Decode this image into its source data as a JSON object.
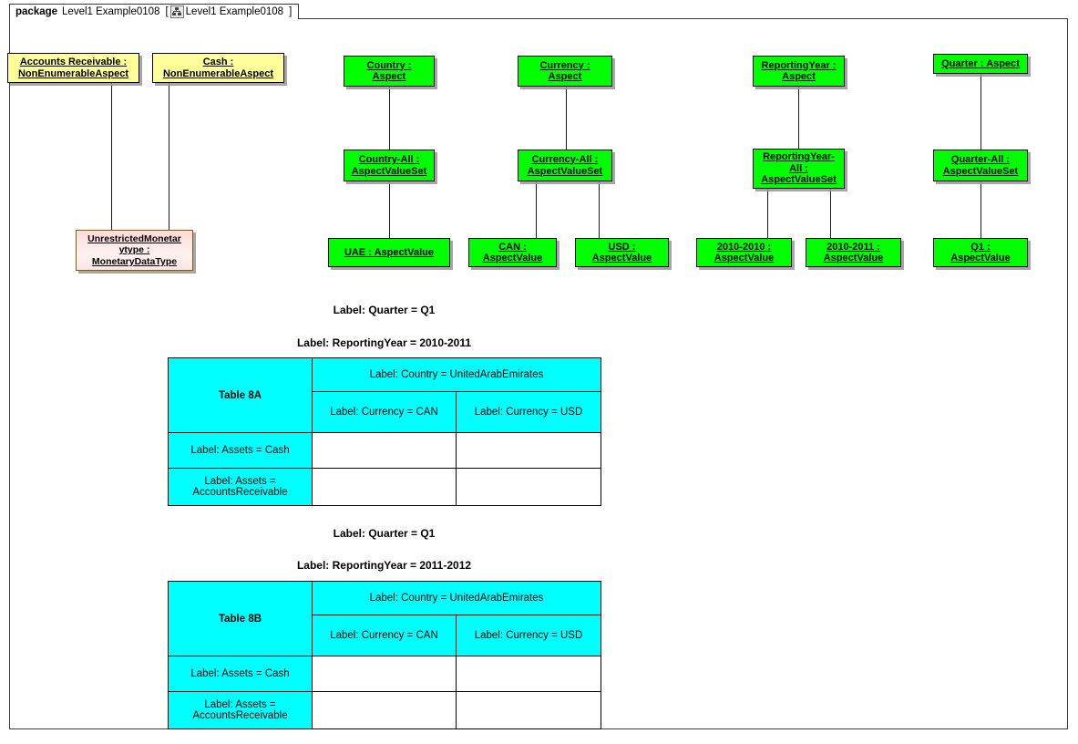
{
  "package": {
    "keyword": "package",
    "name": "Level1 Example0108",
    "bracket_open": "[",
    "icon": "class-diagram-icon",
    "tab_name": "Level1 Example0108",
    "bracket_close": "]"
  },
  "colors": {
    "aspect_node": "#00ff00",
    "non_enumerable_aspect_node": "#ffff99",
    "datatype_node": "#ffd9d9",
    "table_header": "#00ffff",
    "border": "#000000",
    "line": "#1a1a1a"
  },
  "nodes": {
    "accounts_receivable": {
      "line1": "Accounts Receivable :",
      "line2": "NonEnumerableAspect"
    },
    "cash": {
      "line1": "Cash :",
      "line2": "NonEnumerableAspect"
    },
    "unrestricted_monetary": {
      "line1": "UnrestrictedMonetar",
      "line2": "ytype :",
      "line3": "MonetaryDataType"
    },
    "country": {
      "line1": "Country :",
      "line2": "Aspect"
    },
    "country_all": {
      "line1": "Country-All :",
      "line2": "AspectValueSet"
    },
    "uae": {
      "line1": "UAE : AspectValue"
    },
    "currency": {
      "line1": "Currency :",
      "line2": "Aspect"
    },
    "currency_all": {
      "line1": "Currency-All :",
      "line2": "AspectValueSet"
    },
    "can": {
      "line1": "CAN :",
      "line2": "AspectValue"
    },
    "usd": {
      "line1": "USD :",
      "line2": "AspectValue"
    },
    "reporting_year": {
      "line1": "ReportingYear :",
      "line2": "Aspect"
    },
    "reporting_year_all": {
      "line1": "ReportingYear-",
      "line2": "All :",
      "line3": "AspectValueSet"
    },
    "year_2010_2010": {
      "line1": "2010-2010 :",
      "line2": "AspectValue"
    },
    "year_2010_2011": {
      "line1": "2010-2011 :",
      "line2": "AspectValue"
    },
    "quarter": {
      "line1": "Quarter : Aspect"
    },
    "quarter_all": {
      "line1": "Quarter-All :",
      "line2": "AspectValueSet"
    },
    "q1": {
      "line1": "Q1 :",
      "line2": "AspectValue"
    }
  },
  "table_a": {
    "label_quarter": "Label: Quarter = Q1",
    "label_reporting_year": "Label: ReportingYear = 2010-2011",
    "corner": "Table 8A",
    "country_header": "Label: Country = UnitedArabEmirates",
    "currency_headers": [
      "Label: Currency = CAN",
      "Label: Currency = USD"
    ],
    "rows": [
      {
        "header": "Label: Assets = Cash",
        "cells": [
          "",
          ""
        ]
      },
      {
        "header": "Label: Assets = AccountsReceivable",
        "cells": [
          "",
          ""
        ]
      }
    ]
  },
  "table_b": {
    "label_quarter": "Label: Quarter = Q1",
    "label_reporting_year": "Label: ReportingYear = 2011-2012",
    "corner": "Table 8B",
    "country_header": "Label: Country = UnitedArabEmirates",
    "currency_headers": [
      "Label: Currency = CAN",
      "Label: Currency = USD"
    ],
    "rows": [
      {
        "header": "Label: Assets = Cash",
        "cells": [
          "",
          ""
        ]
      },
      {
        "header": "Label: Assets = AccountsReceivable",
        "cells": [
          "",
          ""
        ]
      }
    ]
  }
}
